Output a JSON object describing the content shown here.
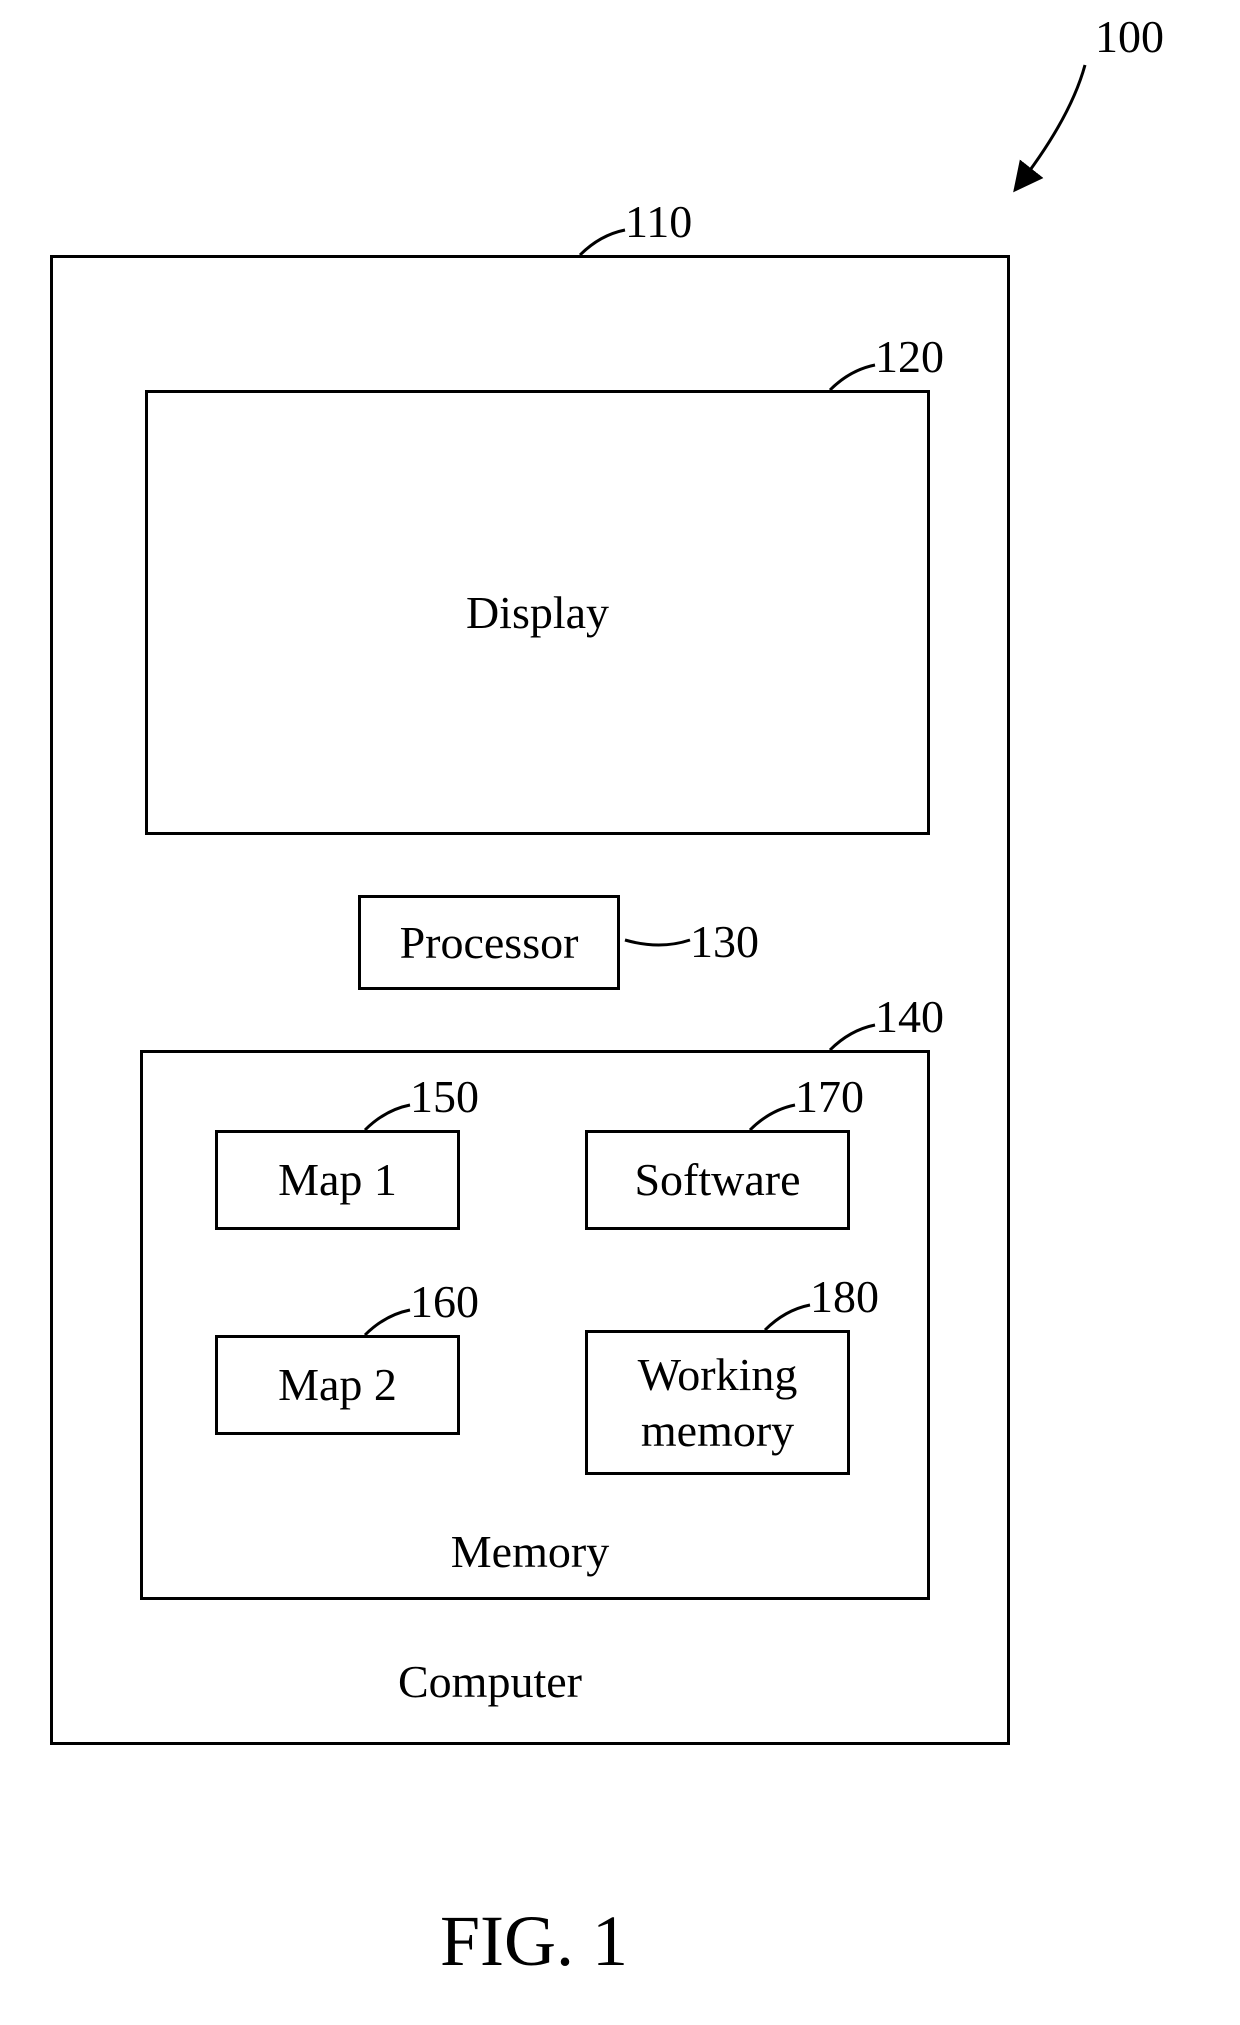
{
  "refs": {
    "r100": "100",
    "r110": "110",
    "r120": "120",
    "r130": "130",
    "r140": "140",
    "r150": "150",
    "r160": "160",
    "r170": "170",
    "r180": "180"
  },
  "blocks": {
    "computer": "Computer",
    "display": "Display",
    "processor": "Processor",
    "memory": "Memory",
    "map1": "Map 1",
    "map2": "Map 2",
    "software": "Software",
    "working_memory": "Working\nmemory"
  },
  "figure_caption": "FIG. 1"
}
